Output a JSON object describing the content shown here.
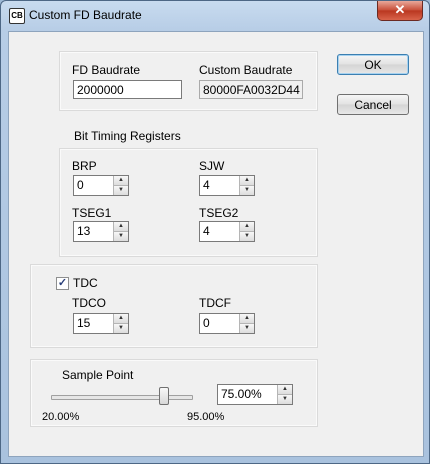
{
  "window": {
    "title": "Custom FD Baudrate",
    "close_label": "✕"
  },
  "buttons": {
    "ok": "OK",
    "cancel": "Cancel"
  },
  "baudrate": {
    "fd_label": "FD Baudrate",
    "fd_value": "2000000",
    "custom_label": "Custom Baudrate",
    "custom_value": "80000FA0032D44"
  },
  "bit_timing": {
    "heading": "Bit Timing Registers",
    "brp_label": "BRP",
    "brp_value": "0",
    "sjw_label": "SJW",
    "sjw_value": "4",
    "tseg1_label": "TSEG1",
    "tseg1_value": "13",
    "tseg2_label": "TSEG2",
    "tseg2_value": "4"
  },
  "tdc": {
    "checkbox_label": "TDC",
    "checked": true,
    "tdco_label": "TDCO",
    "tdco_value": "15",
    "tdcf_label": "TDCF",
    "tdcf_value": "0"
  },
  "sample_point": {
    "label": "Sample Point",
    "value": "75.00%",
    "min_label": "20.00%",
    "max_label": "95.00%",
    "level_fraction": 0.733
  }
}
